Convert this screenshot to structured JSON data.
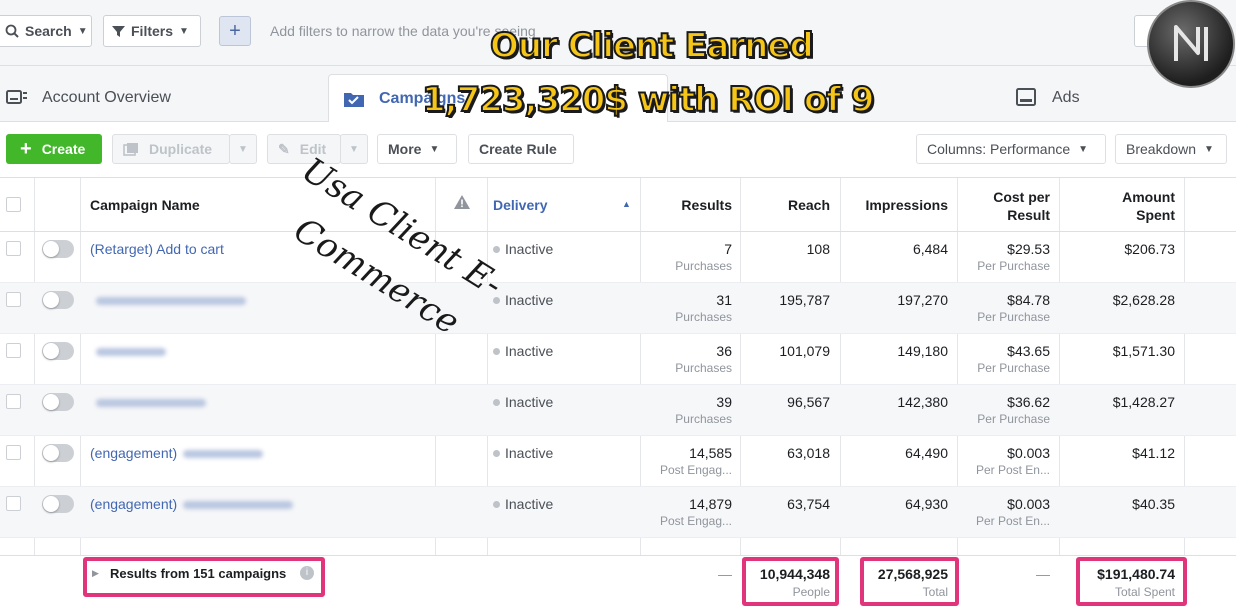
{
  "filterbar": {
    "search_label": "Search",
    "filters_label": "Filters",
    "add_label": "+",
    "placeholder": "Add filters to narrow the data you're seeing"
  },
  "tabs": [
    {
      "label": "Account Overview"
    },
    {
      "label": "Campaigns"
    },
    {
      "label": "Ads"
    }
  ],
  "toolbar": {
    "create_label": "Create",
    "duplicate_label": "Duplicate",
    "edit_label": "Edit",
    "more_label": "More",
    "create_rule_label": "Create Rule",
    "columns_label": "Columns: Performance",
    "breakdown_label": "Breakdown"
  },
  "table": {
    "headers": {
      "campaign_name": "Campaign Name",
      "delivery": "Delivery",
      "results": "Results",
      "reach": "Reach",
      "impressions": "Impressions",
      "cost_per_result_1": "Cost per",
      "cost_per_result_2": "Result",
      "amount_spent_1": "Amount",
      "amount_spent_2": "Spent"
    },
    "rows": [
      {
        "name": "(Retarget) Add to cart",
        "delivery": "Inactive",
        "results": "7",
        "results_type": "Purchases",
        "reach": "108",
        "impressions": "6,484",
        "cost": "$29.53",
        "cost_type": "Per Purchase",
        "spent": "$206.73"
      },
      {
        "name": "",
        "delivery": "Inactive",
        "results": "31",
        "results_type": "Purchases",
        "reach": "195,787",
        "impressions": "197,270",
        "cost": "$84.78",
        "cost_type": "Per Purchase",
        "spent": "$2,628.28"
      },
      {
        "name": "",
        "delivery": "Inactive",
        "results": "36",
        "results_type": "Purchases",
        "reach": "101,079",
        "impressions": "149,180",
        "cost": "$43.65",
        "cost_type": "Per Purchase",
        "spent": "$1,571.30"
      },
      {
        "name": "",
        "delivery": "Inactive",
        "results": "39",
        "results_type": "Purchases",
        "reach": "96,567",
        "impressions": "142,380",
        "cost": "$36.62",
        "cost_type": "Per Purchase",
        "spent": "$1,428.27"
      },
      {
        "name": "(engagement)",
        "delivery": "Inactive",
        "results": "14,585",
        "results_type": "Post Engag...",
        "reach": "63,018",
        "impressions": "64,490",
        "cost": "$0.003",
        "cost_type": "Per Post En...",
        "spent": "$41.12"
      },
      {
        "name": "(engagement)",
        "delivery": "Inactive",
        "results": "14,879",
        "results_type": "Post Engag...",
        "reach": "63,754",
        "impressions": "64,930",
        "cost": "$0.003",
        "cost_type": "Per Post En...",
        "spent": "$40.35"
      }
    ]
  },
  "footer": {
    "results_label": "Results from 151 campaigns",
    "results_dash": "—",
    "reach": "10,944,348",
    "reach_sub": "People",
    "impressions": "27,568,925",
    "impressions_sub": "Total",
    "cost_dash": "—",
    "spent": "$191,480.74",
    "spent_sub": "Total Spent"
  },
  "overlay": {
    "headline_1": "Our Client Earned",
    "headline_2": "1,723,320$  with ROI of  9",
    "script_1": "Usa Client  E-",
    "script_2": "Commerce"
  },
  "colors": {
    "accent_blue": "#4267b2",
    "create_green": "#42b72a",
    "highlight_pink": "#e0357a",
    "headline_yellow": "#f5c518"
  }
}
